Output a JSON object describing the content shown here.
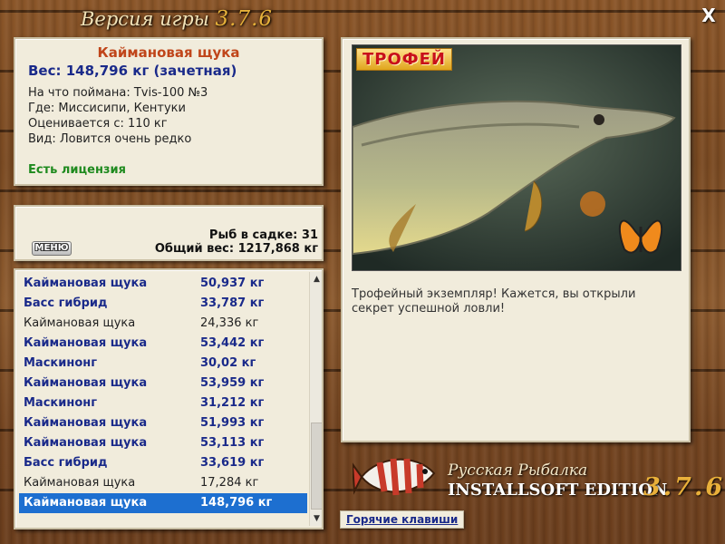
{
  "header": {
    "title_text": "Версия игры ",
    "title_version": "3.7.6",
    "close_glyph": "X"
  },
  "fish_info": {
    "name": "Каймановая щука",
    "weight": "Вес: 148,796 кг (зачетная)",
    "caught_with": "На что поймана: Tvis-100 №3",
    "location": "Где: Миссисипи, Кентуки",
    "scored_from": "Оценивается с: 110 кг",
    "kind": "Вид: Ловится очень редко",
    "license": "Есть лицензия"
  },
  "cage": {
    "menu_label": "МЕНЮ",
    "fish_count": "Рыб в садке: 31",
    "total_weight": "Общий вес: 1217,868 кг"
  },
  "fish_list": [
    {
      "name": "Каймановая щука",
      "weight": "50,937 кг",
      "style": "bold"
    },
    {
      "name": "Басс гибрид",
      "weight": "33,787 кг",
      "style": "bold"
    },
    {
      "name": "Каймановая щука",
      "weight": "24,336 кг",
      "style": "plain"
    },
    {
      "name": "Каймановая щука",
      "weight": "53,442 кг",
      "style": "bold"
    },
    {
      "name": "Маскинонг",
      "weight": "30,02 кг",
      "style": "bold"
    },
    {
      "name": "Каймановая щука",
      "weight": "53,959 кг",
      "style": "bold"
    },
    {
      "name": "Маскинонг",
      "weight": "31,212 кг",
      "style": "bold"
    },
    {
      "name": "Каймановая щука",
      "weight": "51,993 кг",
      "style": "bold"
    },
    {
      "name": "Каймановая щука",
      "weight": "53,113 кг",
      "style": "bold"
    },
    {
      "name": "Басс гибрид",
      "weight": "33,619 кг",
      "style": "bold"
    },
    {
      "name": "Каймановая щука",
      "weight": "17,284 кг",
      "style": "plain"
    },
    {
      "name": "Каймановая щука",
      "weight": "148,796 кг",
      "style": "selected"
    }
  ],
  "trophy": {
    "badge": "ТРОФЕЙ",
    "caption": "Трофейный экземпляр! Кажется, вы открыли секрет успешной ловли!"
  },
  "brand": {
    "title": "Русская Рыбалка",
    "edition": "INSTALLSOFT EDITION",
    "version": "3.7.6"
  },
  "hotkeys_label": "Горячие клавиши",
  "colors": {
    "accent_name": "#c0451a",
    "list_blue": "#1a2a8a",
    "selection": "#1d6fd0",
    "license_green": "#1e8a1e"
  }
}
